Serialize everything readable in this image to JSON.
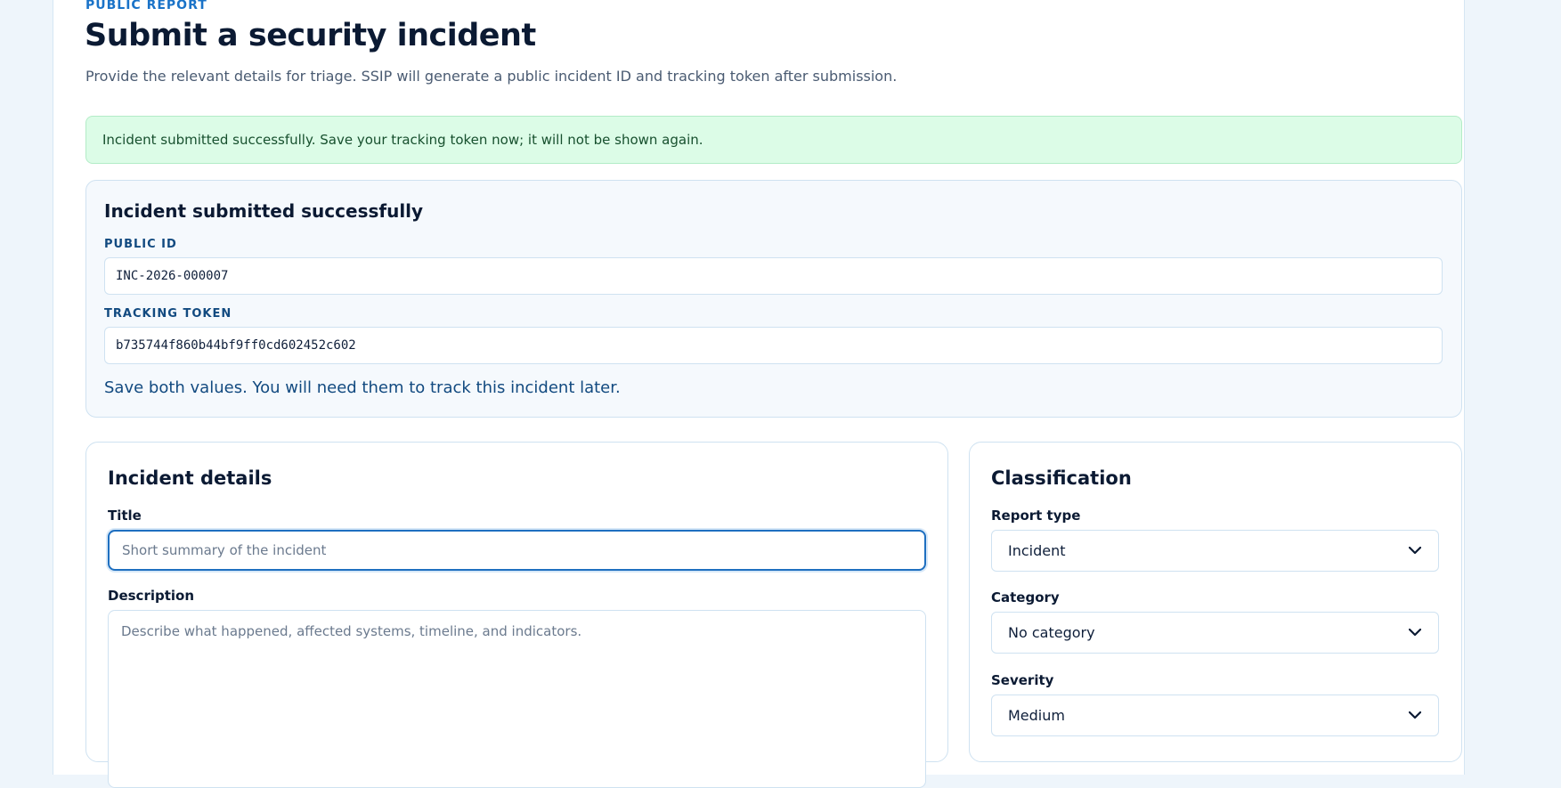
{
  "header": {
    "eyebrow": "PUBLIC REPORT",
    "title": "Submit a security incident",
    "subtitle": "Provide the relevant details for triage. SSIP will generate a public incident ID and tracking token after submission."
  },
  "banner": {
    "message": "Incident submitted successfully. Save your tracking token now; it will not be shown again."
  },
  "result": {
    "heading": "Incident submitted successfully",
    "public_id_label": "PUBLIC ID",
    "public_id_value": "INC-2026-000007",
    "token_label": "TRACKING TOKEN",
    "token_value": "b735744f860b44bf9ff0cd602452c602",
    "note": "Save both values. You will need them to track this incident later."
  },
  "details": {
    "heading": "Incident details",
    "title_label": "Title",
    "title_placeholder": "Short summary of the incident",
    "title_value": "",
    "description_label": "Description",
    "description_placeholder": "Describe what happened, affected systems, timeline, and indicators.",
    "description_value": ""
  },
  "classification": {
    "heading": "Classification",
    "report_type_label": "Report type",
    "report_type_value": "Incident",
    "category_label": "Category",
    "category_value": "No category",
    "severity_label": "Severity",
    "severity_value": "Medium"
  },
  "icons": {
    "select_chevron": "chevron-down-icon"
  },
  "colors": {
    "accent": "#1e6fc0",
    "success_bg": "#dcfce7",
    "success_text": "#17502e",
    "heading": "#0b1a33",
    "label_blue": "#124a80"
  }
}
